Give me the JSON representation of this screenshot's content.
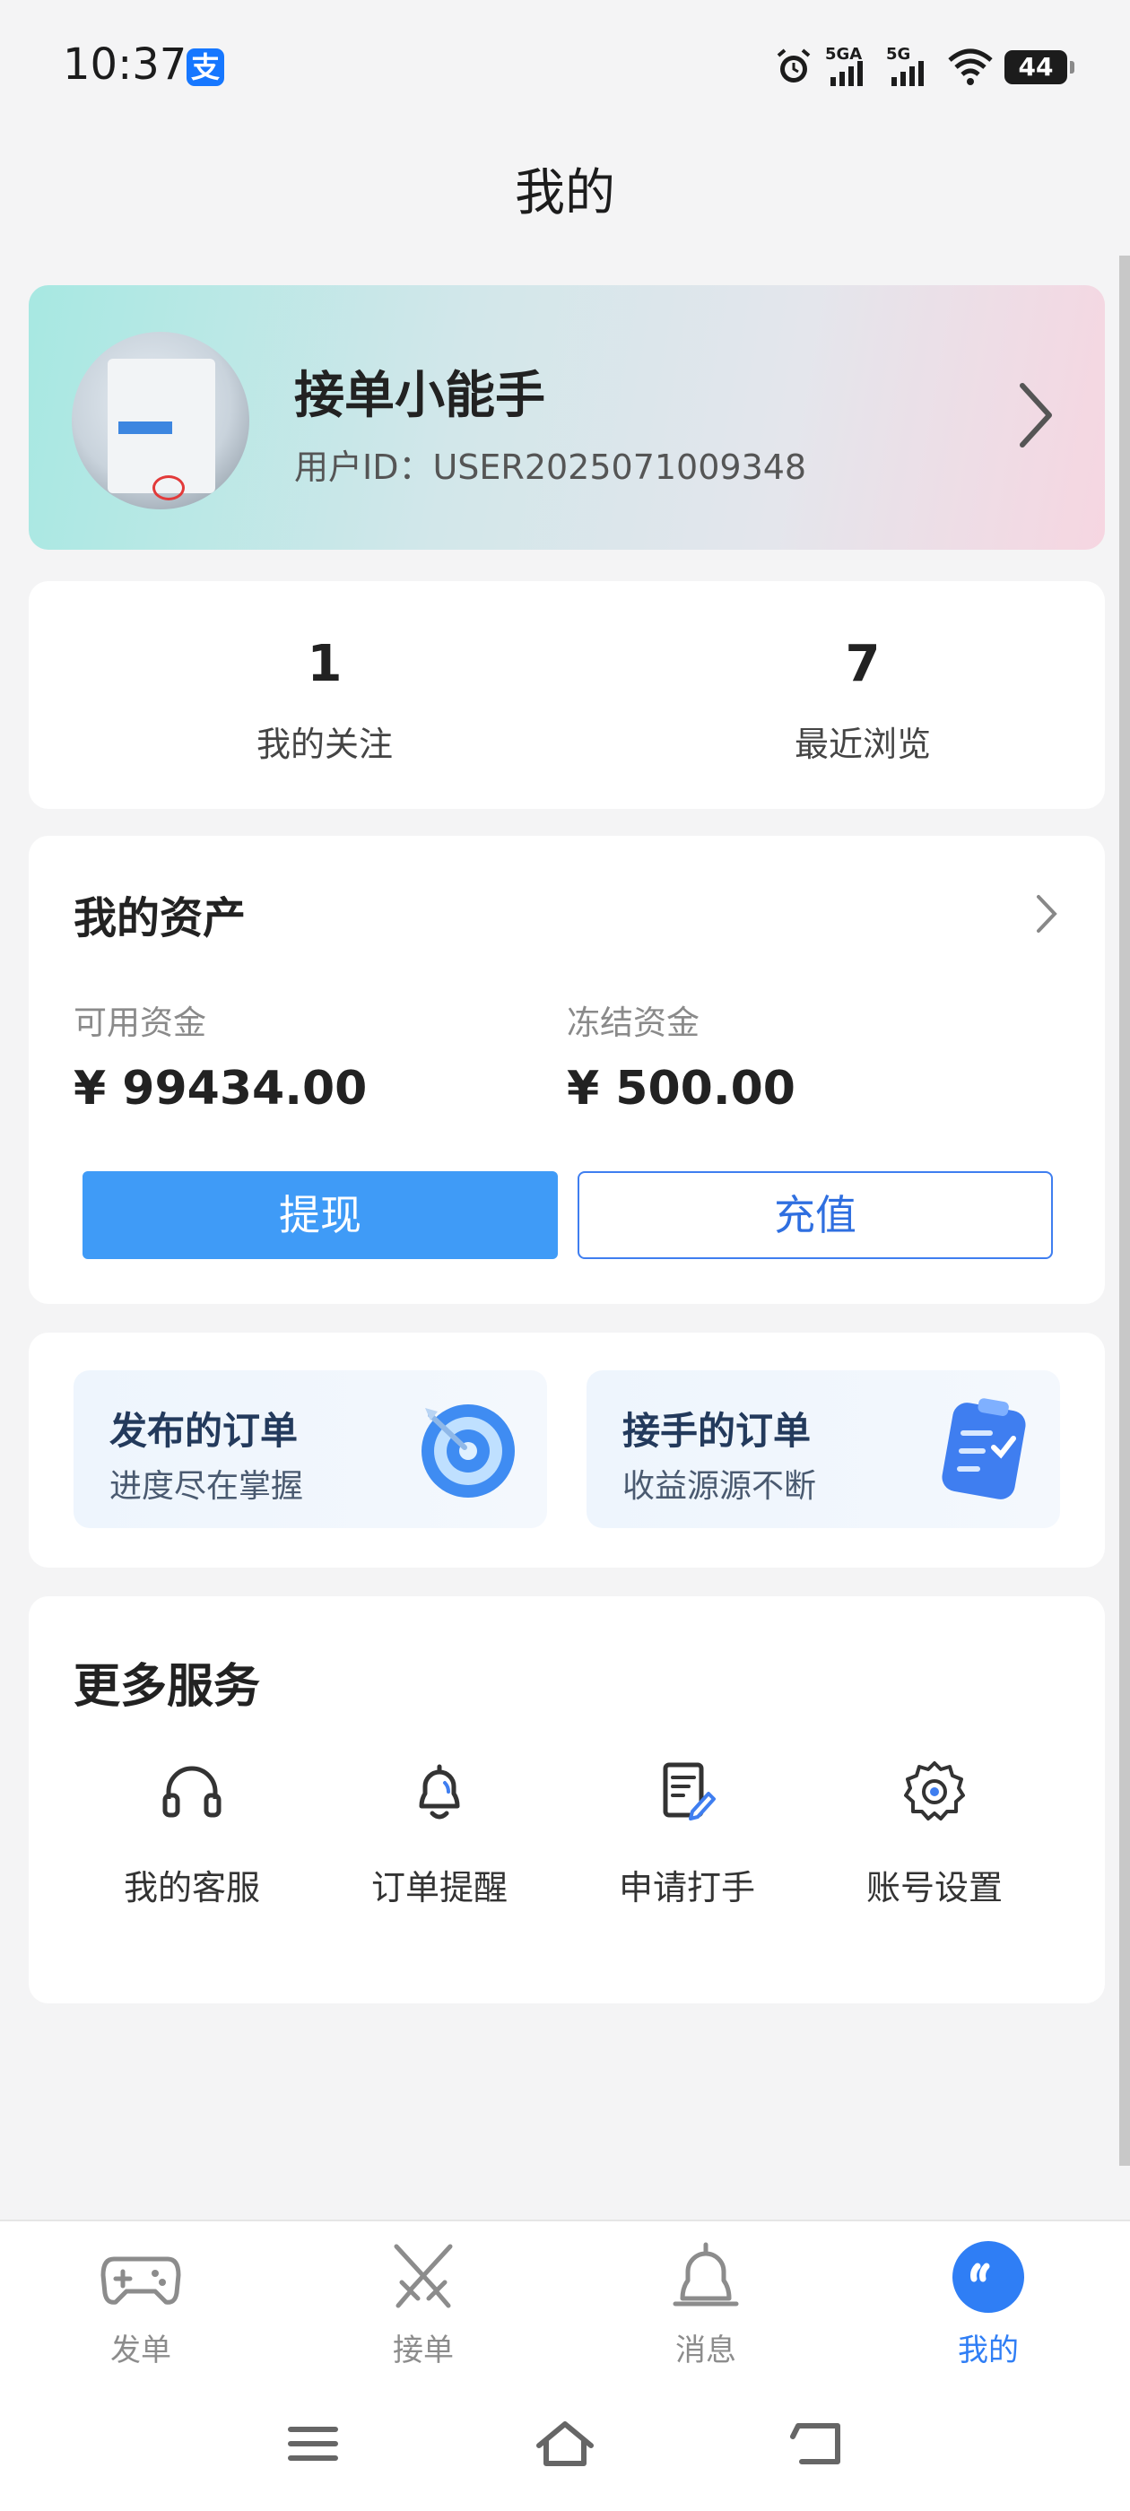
{
  "status_bar": {
    "time": "10:37",
    "app_badge": "支",
    "signal1_label": "5GA",
    "signal2_label": "5G",
    "battery": "44"
  },
  "header": {
    "title": "我的"
  },
  "profile": {
    "name": "接单小能手",
    "user_id": "用户ID：USER2025071009348"
  },
  "stats": [
    {
      "value": "1",
      "label": "我的关注"
    },
    {
      "value": "7",
      "label": "最近浏览"
    }
  ],
  "assets": {
    "title": "我的资产",
    "available_label": "可用资金",
    "available_value": "¥ 99434.00",
    "frozen_label": "冻结资金",
    "frozen_value": "¥ 500.00",
    "withdraw_label": "提现",
    "recharge_label": "充值"
  },
  "orders": [
    {
      "title": "发布的订单",
      "subtitle": "进度尽在掌握",
      "icon": "target-icon"
    },
    {
      "title": "接手的订单",
      "subtitle": "收益源源不断",
      "icon": "clipboard-icon"
    }
  ],
  "services": {
    "title": "更多服务",
    "items": [
      {
        "label": "我的客服",
        "icon": "headset-icon"
      },
      {
        "label": "订单提醒",
        "icon": "bell-icon"
      },
      {
        "label": "申请打手",
        "icon": "edit-document-icon"
      },
      {
        "label": "账号设置",
        "icon": "gear-icon"
      }
    ]
  },
  "bottom_nav": {
    "tabs": [
      {
        "label": "发单",
        "icon": "gamepad-icon",
        "active": false
      },
      {
        "label": "接单",
        "icon": "crossed-swords-icon",
        "active": false
      },
      {
        "label": "消息",
        "icon": "bell-icon",
        "active": false
      },
      {
        "label": "我的",
        "icon": "chat-bubble-icon",
        "active": true
      }
    ]
  },
  "colors": {
    "accent": "#3f9bf7",
    "active_tab": "#2f7ef5",
    "page_bg": "#f4f4f5"
  }
}
